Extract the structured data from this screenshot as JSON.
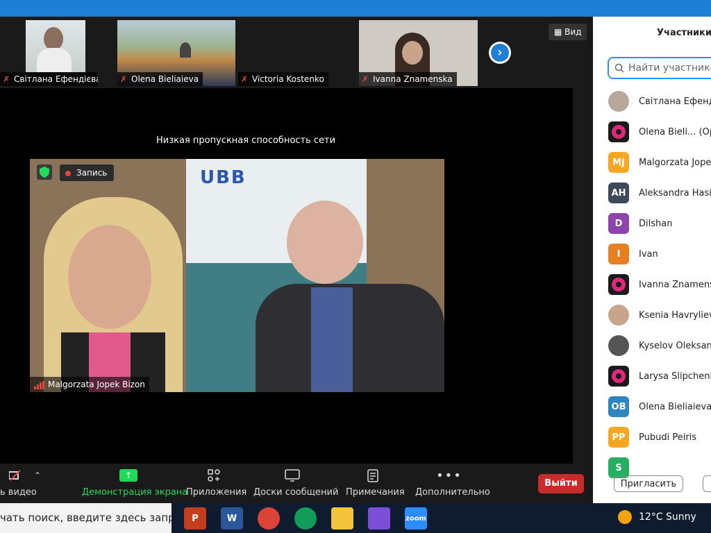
{
  "thumbnails": [
    {
      "name": "Світлана Ефендієва",
      "muted": true
    },
    {
      "name": "Olena Bieliaieva",
      "muted": true
    },
    {
      "name": "Victoria Kostenko",
      "muted": true
    },
    {
      "name": "Ivanna Znamenska",
      "muted": true
    }
  ],
  "view_label": "Вид",
  "stage": {
    "bandwidth_notice": "Низкая пропускная способность сети",
    "recording_label": "Запись",
    "speaker_name": "Malgorzata Jopek Bizon",
    "banner_text": "UBB"
  },
  "toolbar": {
    "video": "ь видео",
    "share": "Демонстрация экрана",
    "apps": "Приложения",
    "whiteboards": "Доски сообщений",
    "notes": "Примечания",
    "more": "Дополнительно",
    "leave": "Выйти"
  },
  "participants_panel": {
    "title": "Участники (",
    "search_placeholder": "Найти участника",
    "invite_label": "Пригласить",
    "participants": [
      {
        "name": "Світлана Ефенді",
        "initials": "",
        "avatar_color": "#b8a89a",
        "kind": "photo"
      },
      {
        "name": "Olena Bieli... (Op",
        "initials": "",
        "avatar_color": "#1a1a1a",
        "kind": "pink-logo"
      },
      {
        "name": "Malgorzata Jope",
        "initials": "MJ",
        "avatar_color": "#f5a623",
        "kind": "initials"
      },
      {
        "name": "Aleksandra Hasic",
        "initials": "AH",
        "avatar_color": "#3d4a5c",
        "kind": "initials"
      },
      {
        "name": "Dilshan",
        "initials": "D",
        "avatar_color": "#8e44ad",
        "kind": "initials"
      },
      {
        "name": "Ivan",
        "initials": "I",
        "avatar_color": "#e67e22",
        "kind": "initials"
      },
      {
        "name": "Ivanna Znamensk",
        "initials": "",
        "avatar_color": "#1a1a1a",
        "kind": "pink-logo"
      },
      {
        "name": "Ksenia Havrylieva",
        "initials": "",
        "avatar_color": "#c9a38a",
        "kind": "photo"
      },
      {
        "name": "Kyselov Oleksanc",
        "initials": "",
        "avatar_color": "#555555",
        "kind": "photo"
      },
      {
        "name": "Larysa Slipchenko",
        "initials": "",
        "avatar_color": "#1a1a1a",
        "kind": "pink-logo"
      },
      {
        "name": "Olena Bieliaieva",
        "initials": "OB",
        "avatar_color": "#2e86c1",
        "kind": "initials"
      },
      {
        "name": "Pubudi Peiris",
        "initials": "PP",
        "avatar_color": "#f5a623",
        "kind": "initials"
      },
      {
        "name": "",
        "initials": "S",
        "avatar_color": "#27ae60",
        "kind": "initials"
      }
    ]
  },
  "taskbar": {
    "search_text": "чать поиск, введите здесь запрос",
    "weather_temp": "12°C",
    "weather_desc": "Sunny",
    "apps": [
      {
        "name": "powerpoint-icon",
        "label": "P",
        "color": "#c43e1c"
      },
      {
        "name": "word-icon",
        "label": "W",
        "color": "#2b579a"
      },
      {
        "name": "chrome-icon",
        "label": "",
        "color": "#db4437"
      },
      {
        "name": "chrome-profile-icon",
        "label": "",
        "color": "#0f9d58"
      },
      {
        "name": "file-explorer-icon",
        "label": "",
        "color": "#f3c33c"
      },
      {
        "name": "paint-icon",
        "label": "",
        "color": "#7b4fd6"
      },
      {
        "name": "zoom-icon",
        "label": "zoom",
        "color": "#2d8cff"
      }
    ]
  },
  "colors": {
    "accent": "#1f7fd6",
    "leave": "#c92a2a",
    "search_border": "#2d8cff",
    "share_green": "#23d959"
  }
}
